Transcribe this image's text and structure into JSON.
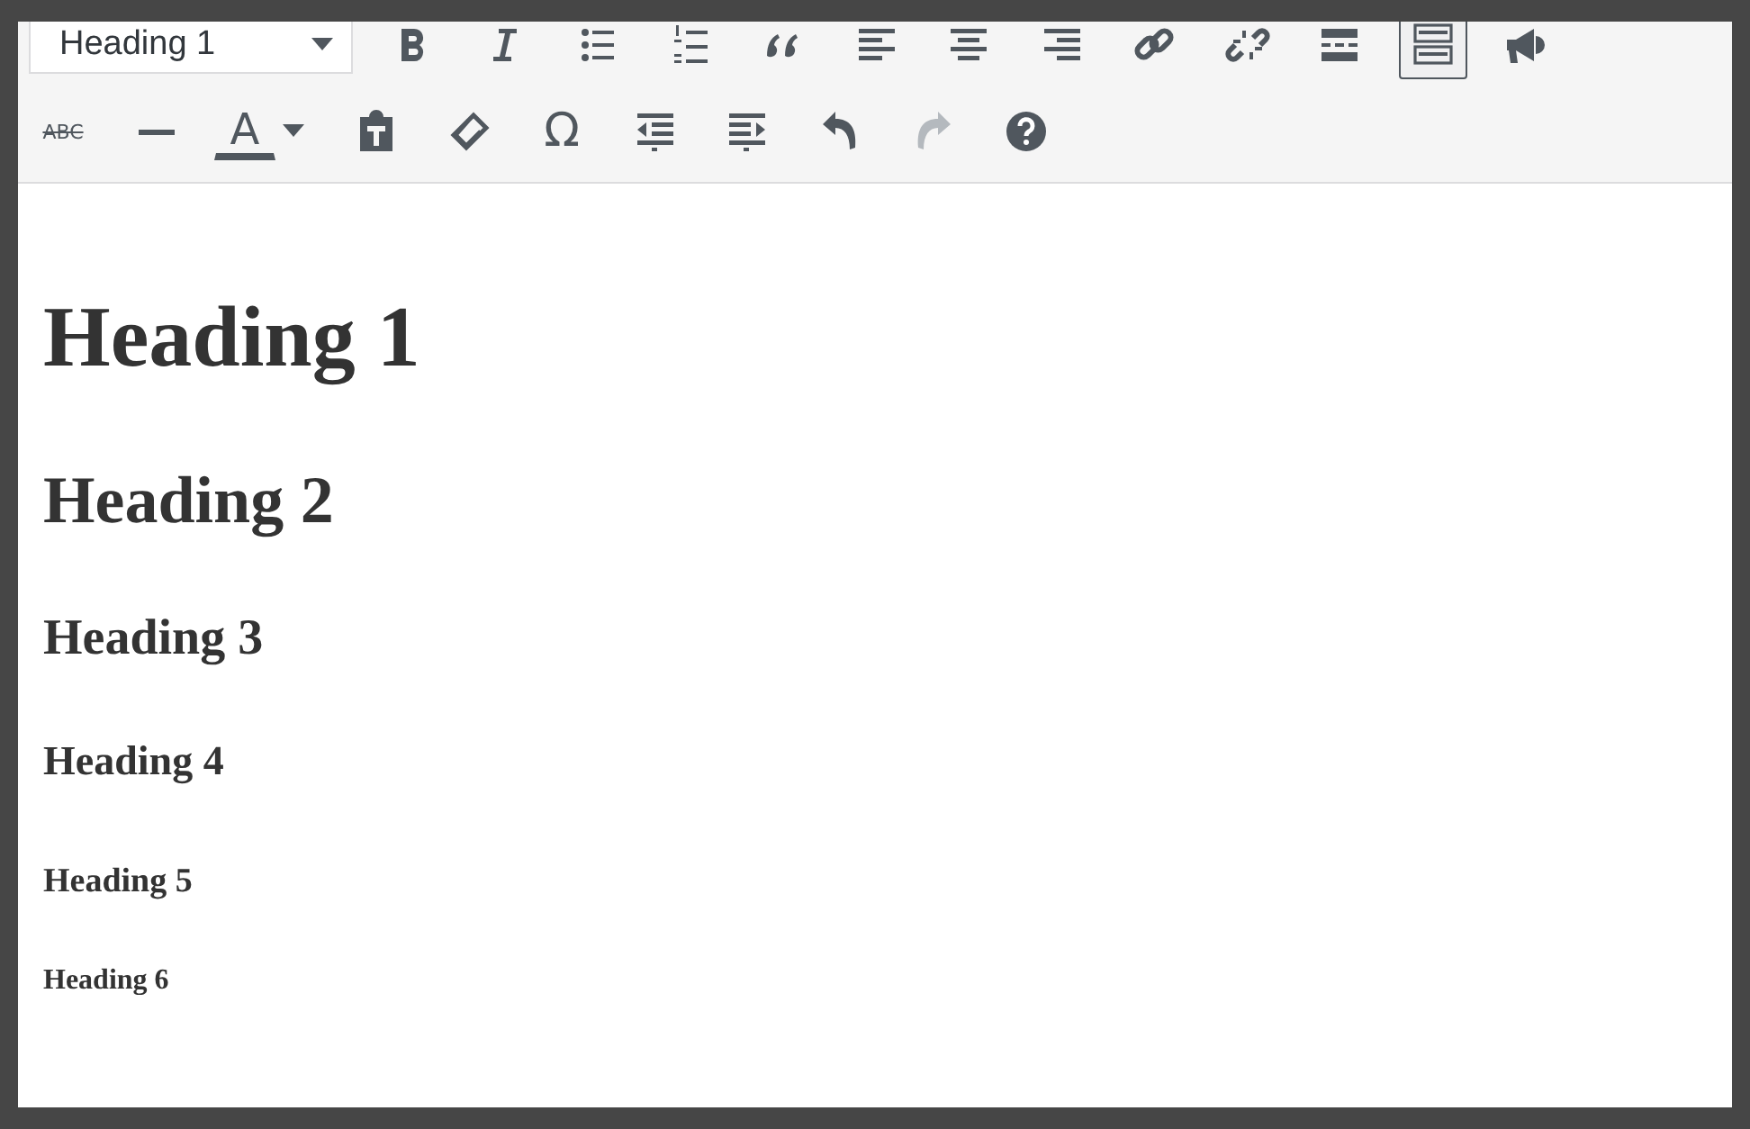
{
  "toolbar": {
    "rows": [
      {
        "items": [
          {
            "kind": "format-select",
            "value": "Heading 1"
          },
          {
            "kind": "bold"
          },
          {
            "kind": "italic"
          },
          {
            "kind": "bullet-list"
          },
          {
            "kind": "numbered-list"
          },
          {
            "kind": "blockquote"
          },
          {
            "kind": "align-left"
          },
          {
            "kind": "align-center"
          },
          {
            "kind": "align-right"
          },
          {
            "kind": "link"
          },
          {
            "kind": "unlink"
          },
          {
            "kind": "read-more"
          },
          {
            "kind": "toolbar-toggle",
            "selected": true
          },
          {
            "kind": "megaphone"
          }
        ]
      },
      {
        "items": [
          {
            "kind": "strikethrough",
            "label": "ABC"
          },
          {
            "kind": "horizontal-line"
          },
          {
            "kind": "text-color",
            "label": "A"
          },
          {
            "kind": "paste-text"
          },
          {
            "kind": "eraser"
          },
          {
            "kind": "special-character",
            "label": "Ω"
          },
          {
            "kind": "outdent"
          },
          {
            "kind": "indent"
          },
          {
            "kind": "undo",
            "disabled": false
          },
          {
            "kind": "redo",
            "disabled": true
          },
          {
            "kind": "help"
          }
        ]
      }
    ]
  },
  "content": [
    {
      "kind": "h1",
      "text": "Heading 1"
    },
    {
      "kind": "h2",
      "text": "Heading 2"
    },
    {
      "kind": "h3",
      "text": "Heading 3"
    },
    {
      "kind": "h4",
      "text": "Heading 4"
    },
    {
      "kind": "h5",
      "text": "Heading 5"
    },
    {
      "kind": "h6",
      "text": "Heading 6"
    }
  ]
}
